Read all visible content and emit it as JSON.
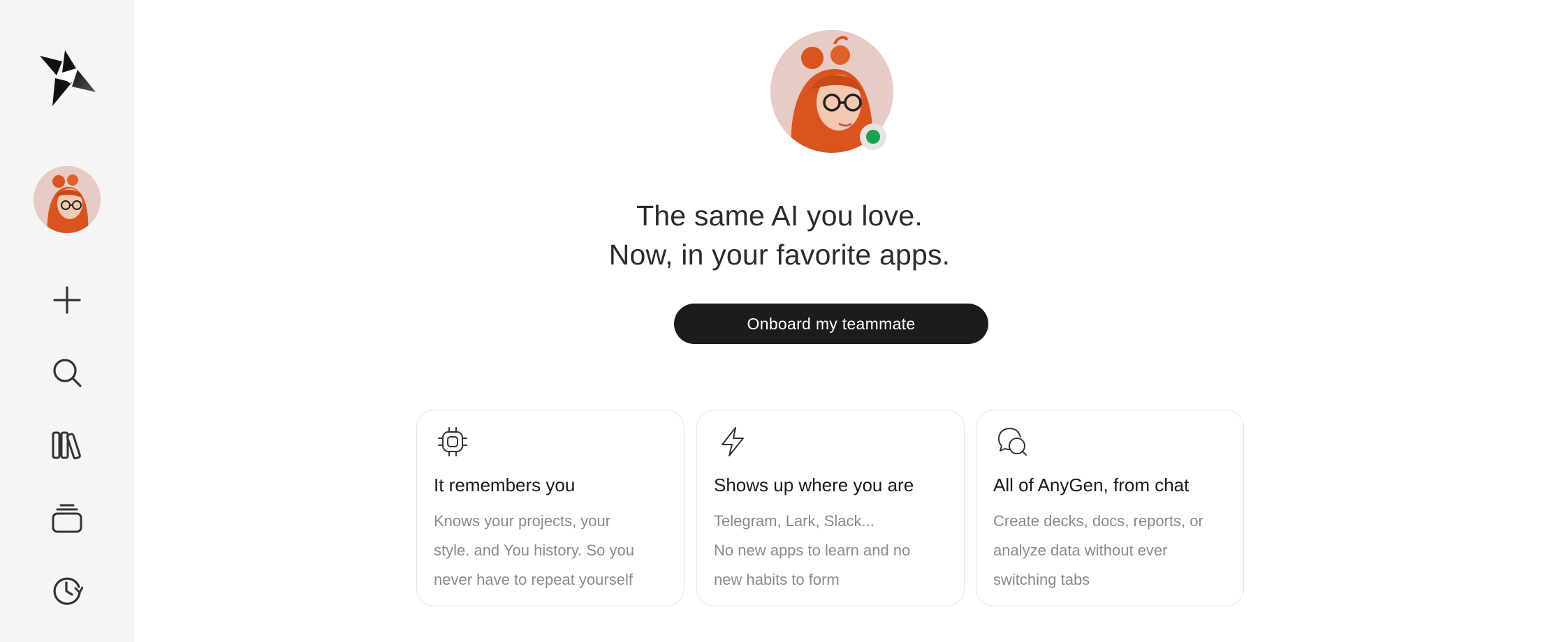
{
  "sidebar": {
    "logo_icon": "anygen-logo",
    "avatar_icon": "user-avatar",
    "items": [
      {
        "name": "new",
        "icon": "plus-icon"
      },
      {
        "name": "search",
        "icon": "search-icon"
      },
      {
        "name": "library",
        "icon": "library-icon"
      },
      {
        "name": "projects",
        "icon": "stack-icon"
      },
      {
        "name": "history",
        "icon": "history-icon"
      }
    ]
  },
  "hero": {
    "status": "online",
    "status_color": "#1aa14b",
    "headline_line1": "The same AI you love.",
    "headline_line2": "Now, in your favorite apps.",
    "cta_label": "Onboard my teammate"
  },
  "cards": [
    {
      "icon": "chip-icon",
      "title": "It remembers you",
      "body_lines": [
        "Knows your projects, your",
        "style. and You history. So you",
        "never have to repeat yourself"
      ]
    },
    {
      "icon": "lightning-icon",
      "title": "Shows up where you are",
      "body_lines": [
        "Telegram, Lark, Slack...",
        "No new apps to learn and no",
        "new habits to form"
      ]
    },
    {
      "icon": "chat-bubbles-icon",
      "title": "All of AnyGen, from chat",
      "body_lines": [
        "Create decks, docs, reports, or",
        "analyze data without ever",
        "switching tabs"
      ]
    }
  ],
  "colors": {
    "sidebar_bg": "#f5f5f5",
    "cta_bg": "#1c1c1c",
    "accent_green": "#1aa14b"
  }
}
